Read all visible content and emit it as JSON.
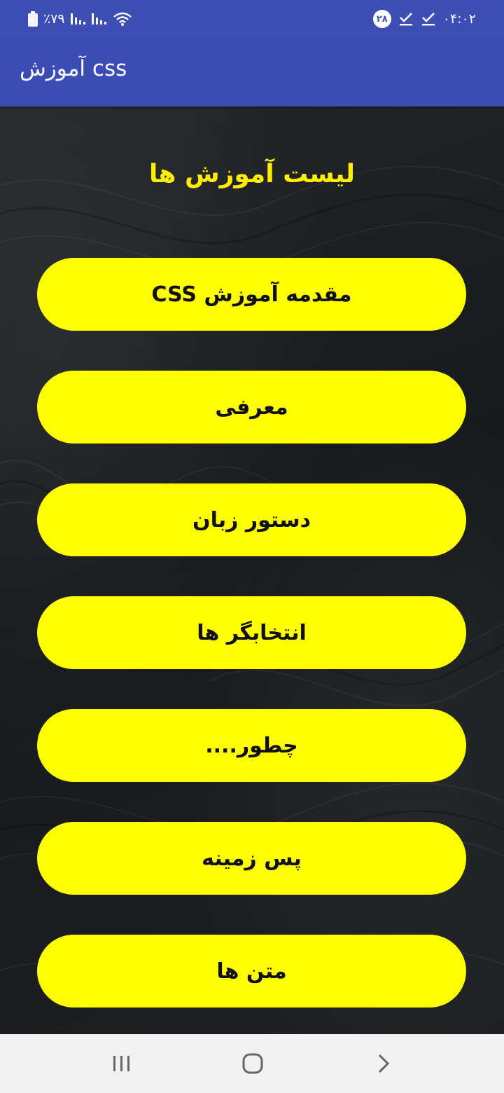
{
  "status_bar": {
    "time": "۰۴:۰۲",
    "badge": "۲۸",
    "battery": "٪۷۹"
  },
  "app_bar": {
    "title": "آموزش css"
  },
  "content": {
    "heading": "لیست آموزش ها",
    "items": [
      {
        "label": "مقدمه آموزش CSS"
      },
      {
        "label": "معرفی"
      },
      {
        "label": "دستور زبان"
      },
      {
        "label": "انتخابگر ها"
      },
      {
        "label": "چطور...."
      },
      {
        "label": "پس زمینه"
      },
      {
        "label": "متن ها"
      }
    ]
  },
  "colors": {
    "status_bar": "#3d4eb5",
    "app_bar": "#3b4db4",
    "button": "#ffff00",
    "heading": "#ffee00",
    "background": "#16181b",
    "nav_bar": "#f1f1f1"
  },
  "icons": {
    "battery": "battery-icon",
    "signal": "signal-icon",
    "wifi": "wifi-icon",
    "check": "check-icon",
    "recents": "recents-icon",
    "home": "home-icon",
    "back": "back-icon"
  }
}
